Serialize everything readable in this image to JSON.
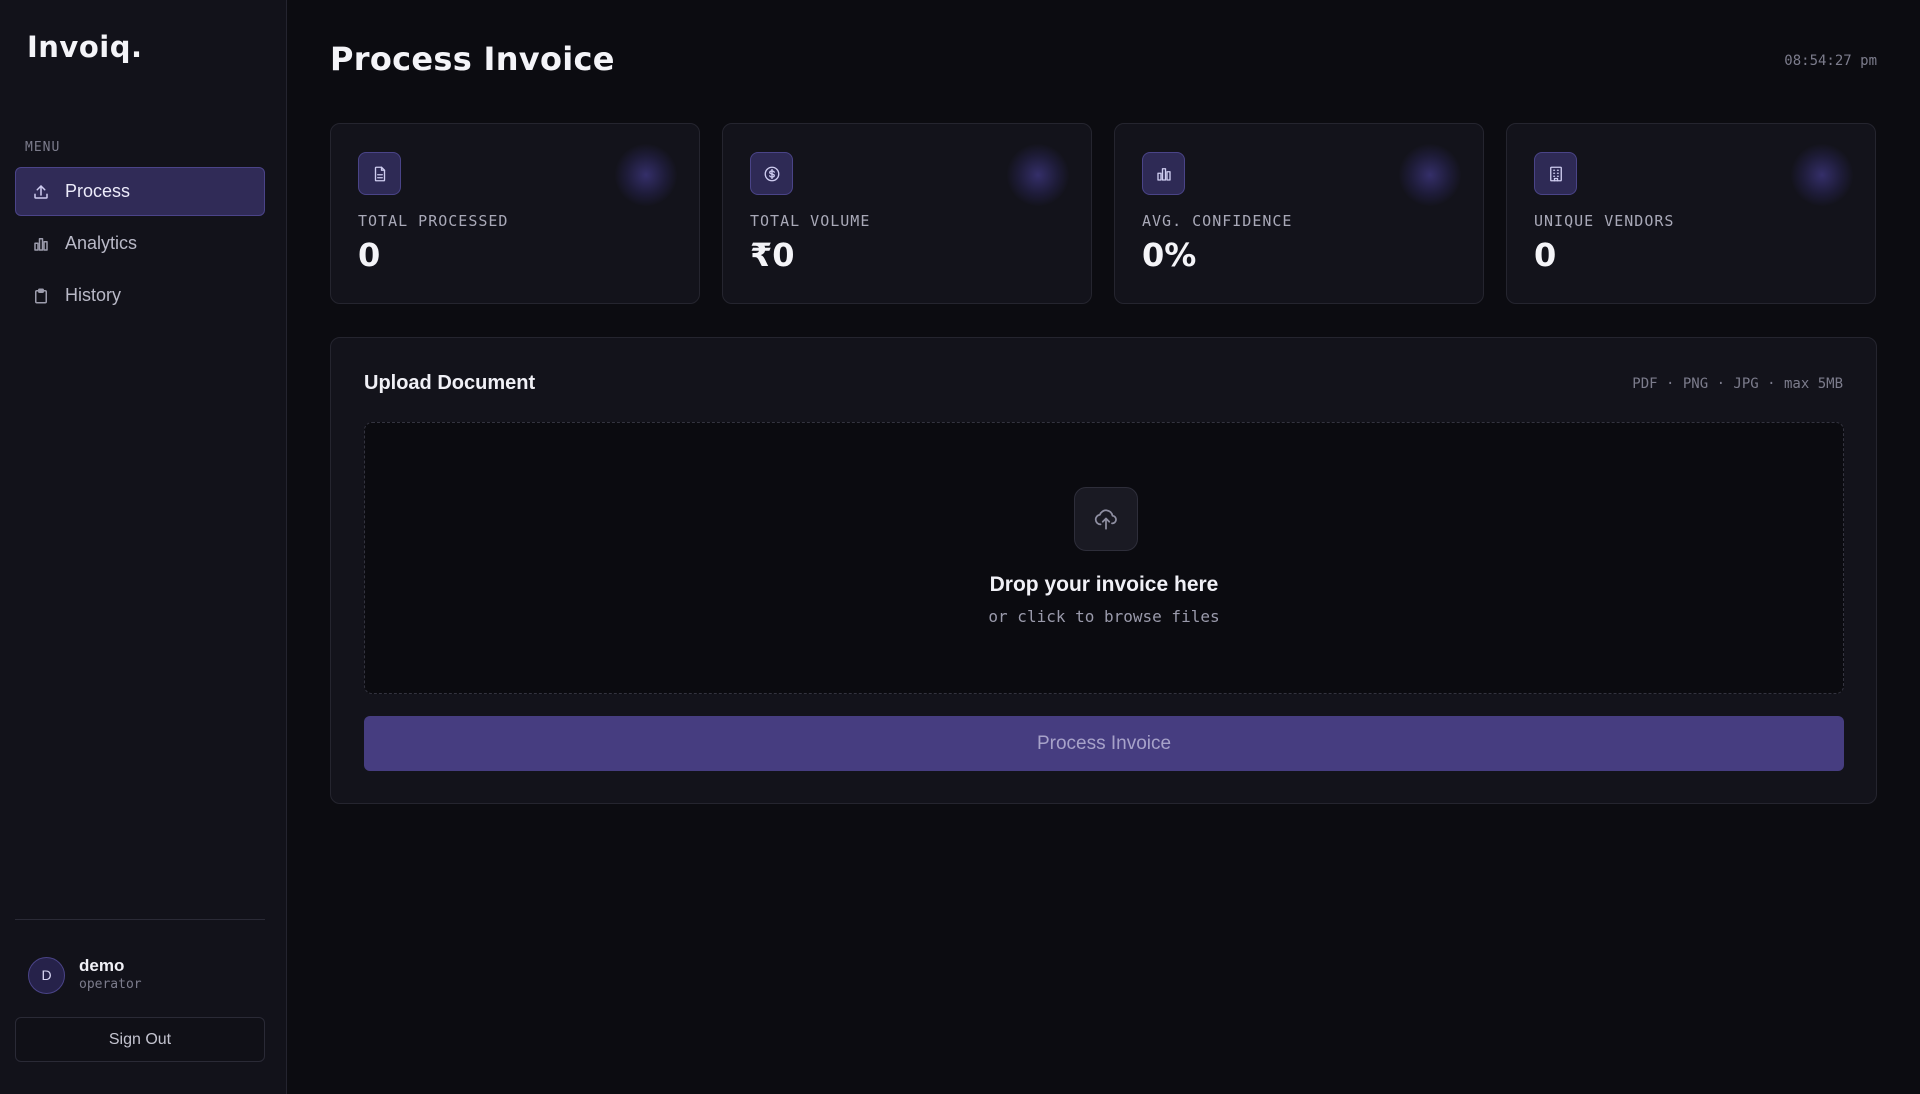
{
  "app": {
    "logo": "Invoiq."
  },
  "sidebar": {
    "menu_heading": "MENU",
    "items": [
      {
        "label": "Process",
        "icon": "upload-icon",
        "active": true
      },
      {
        "label": "Analytics",
        "icon": "bar-chart-icon",
        "active": false
      },
      {
        "label": "History",
        "icon": "clipboard-icon",
        "active": false
      }
    ],
    "user": {
      "initial": "D",
      "name": "demo",
      "role": "operator"
    },
    "sign_out_label": "Sign Out"
  },
  "header": {
    "title": "Process Invoice",
    "clock": "08:54:27 pm"
  },
  "stats": [
    {
      "label": "TOTAL PROCESSED",
      "value": "0",
      "icon": "document-icon"
    },
    {
      "label": "TOTAL VOLUME",
      "value": "₹0",
      "icon": "dollar-coin-icon"
    },
    {
      "label": "AVG. CONFIDENCE",
      "value": "0%",
      "icon": "bar-chart-icon"
    },
    {
      "label": "UNIQUE VENDORS",
      "value": "0",
      "icon": "building-icon"
    }
  ],
  "upload": {
    "title": "Upload Document",
    "formats": "PDF · PNG · JPG · max 5MB",
    "drop_title": "Drop your invoice here",
    "drop_sub": "or click to browse files",
    "button_label": "Process Invoice",
    "icon": "cloud-upload-icon"
  },
  "colors": {
    "accent": "#463d80",
    "accent_border": "#4a4488",
    "background": "#0c0c11",
    "sidebar": "#12121a",
    "card": "#13131b"
  }
}
